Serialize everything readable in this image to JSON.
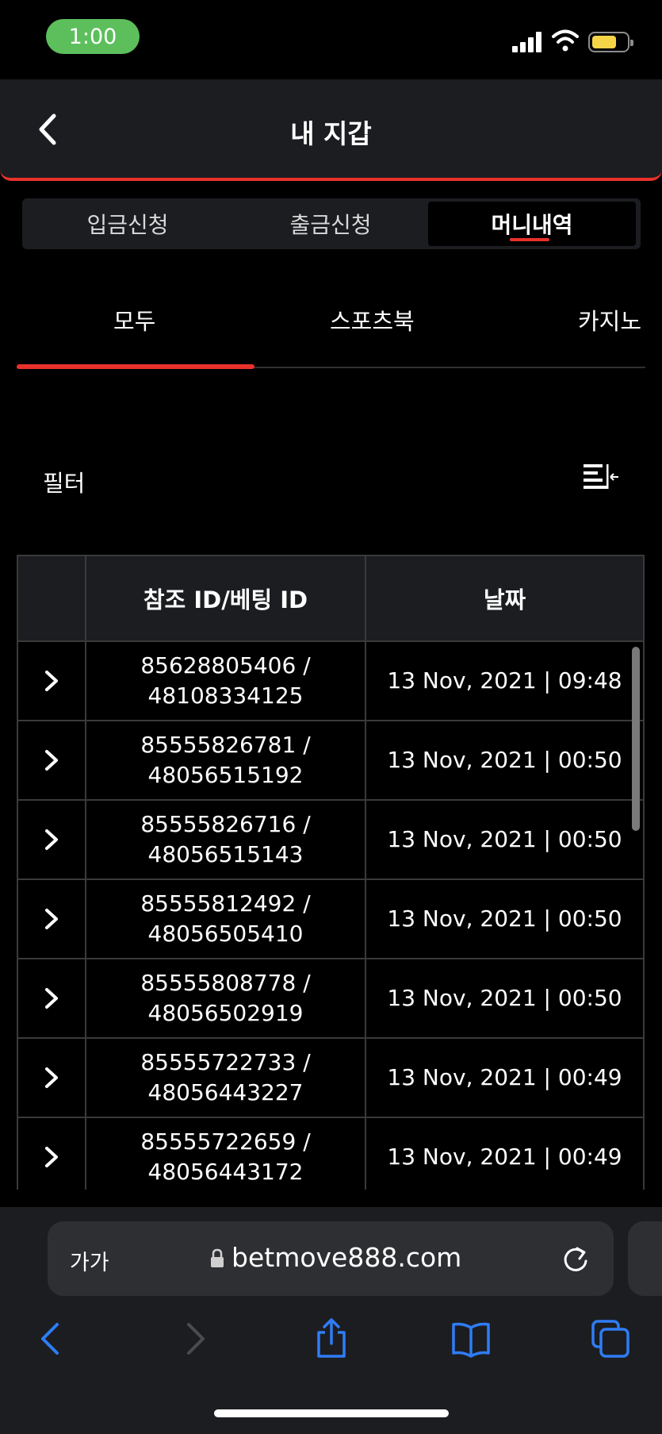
{
  "status_bar": {
    "time": "1:00"
  },
  "header": {
    "title": "내 지갑"
  },
  "segments": [
    {
      "label": "입금신청"
    },
    {
      "label": "출금신청"
    },
    {
      "label": "머니내역"
    }
  ],
  "subtabs": [
    {
      "label": "모두"
    },
    {
      "label": "스포츠북"
    },
    {
      "label": "카지노"
    }
  ],
  "filter": {
    "label": "필터"
  },
  "table": {
    "headers": [
      "",
      "참조 ID/베팅 ID",
      "날짜"
    ],
    "rows": [
      {
        "ref_id": "85628805406 /",
        "bet_id": "48108334125",
        "date": "13 Nov, 2021 | 09:48"
      },
      {
        "ref_id": "85555826781 /",
        "bet_id": "48056515192",
        "date": "13 Nov, 2021 | 00:50"
      },
      {
        "ref_id": "85555826716 /",
        "bet_id": "48056515143",
        "date": "13 Nov, 2021 | 00:50"
      },
      {
        "ref_id": "85555812492 /",
        "bet_id": "48056505410",
        "date": "13 Nov, 2021 | 00:50"
      },
      {
        "ref_id": "85555808778 /",
        "bet_id": "48056502919",
        "date": "13 Nov, 2021 | 00:50"
      },
      {
        "ref_id": "85555722733 /",
        "bet_id": "48056443227",
        "date": "13 Nov, 2021 | 00:49"
      },
      {
        "ref_id": "85555722659 /",
        "bet_id": "48056443172",
        "date": "13 Nov, 2021 | 00:49"
      }
    ]
  },
  "browser": {
    "aa_label": "가가",
    "url": "betmove888.com"
  },
  "colors": {
    "accent": "#e8312b",
    "ios_blue": "#2f7df6",
    "time_pill": "#5cbf5c",
    "battery": "#f5d547"
  }
}
